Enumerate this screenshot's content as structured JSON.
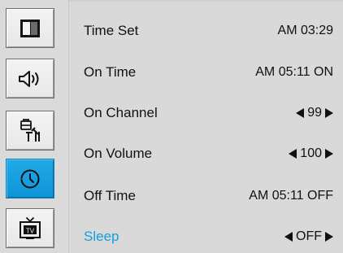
{
  "colors": {
    "background": "#d9d9d9",
    "text": "#111111",
    "accent": "#159de0",
    "active_tile": "#1597db"
  },
  "sidebar": {
    "items": [
      {
        "icon": "picture-icon",
        "active": false
      },
      {
        "icon": "sound-icon",
        "active": false
      },
      {
        "icon": "setup-tools-icon",
        "active": false
      },
      {
        "icon": "clock-icon",
        "active": true
      },
      {
        "icon": "tv-icon",
        "active": false
      }
    ]
  },
  "menu": {
    "rows": [
      {
        "label": "Time Set",
        "value": "AM 03:29"
      },
      {
        "label": "On Time",
        "value": "AM 05:11 ON"
      },
      {
        "label": "On Channel",
        "value": "99"
      },
      {
        "label": "On Volume",
        "value": "100"
      },
      {
        "label": "Off Time",
        "value": "AM 05:11 OFF"
      },
      {
        "label": "Sleep",
        "value": "OFF"
      }
    ]
  }
}
